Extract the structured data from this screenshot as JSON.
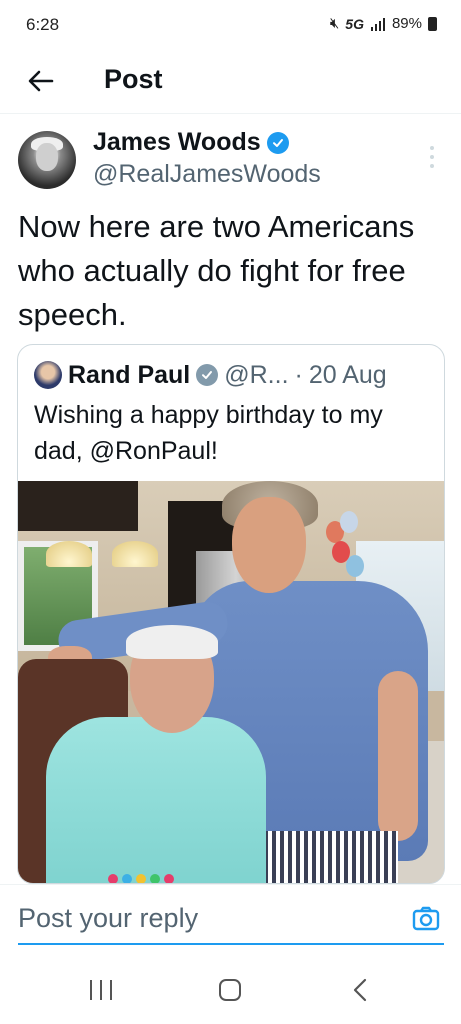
{
  "status_bar": {
    "time": "6:28",
    "network": "5G",
    "battery": "89%"
  },
  "header": {
    "title": "Post"
  },
  "author": {
    "name": "James Woods",
    "handle": "@RealJamesWoods"
  },
  "post": {
    "text": "Now here are two Americans who actually do fight for free speech."
  },
  "quote": {
    "name": "Rand Paul",
    "handle": "@R...",
    "dot": "·",
    "date": "20 Aug",
    "text": "Wishing a happy birthday to my dad, @RonPaul!"
  },
  "reply": {
    "placeholder": "Post your reply"
  },
  "colors": {
    "accent": "#1d9bf0",
    "text": "#0f1419",
    "secondary": "#536471",
    "border": "#cfd9de"
  }
}
